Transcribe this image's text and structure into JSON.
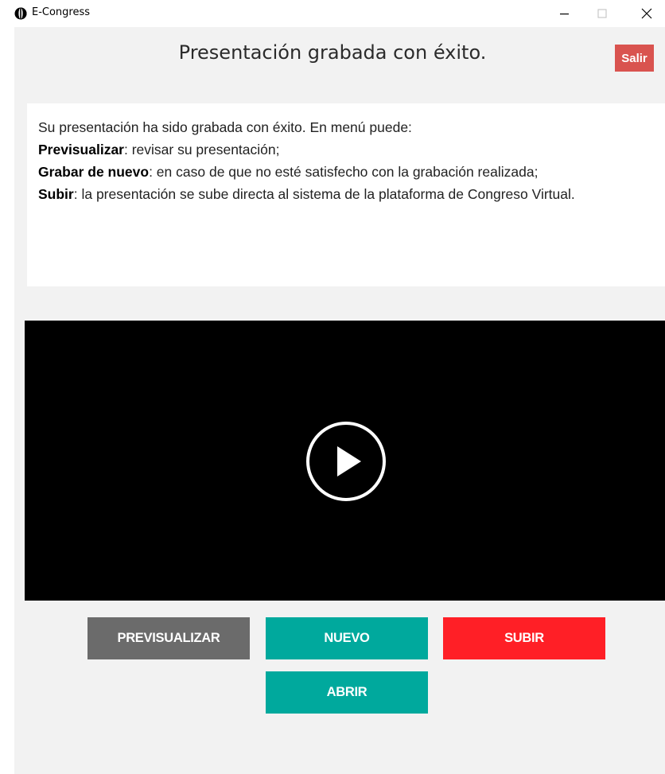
{
  "window": {
    "title": "E-Congress",
    "icon": "e-congress-logo-icon",
    "controls": [
      "minimize-icon",
      "maximize-icon",
      "close-icon"
    ]
  },
  "header": {
    "title": "Presentación grabada con éxito.",
    "exit_label": "Salir"
  },
  "info": {
    "intro": "Su presentación ha sido grabada con éxito. En menú puede:",
    "items": [
      {
        "term": "Previsualizar",
        "desc": ": revisar su presentación;"
      },
      {
        "term": "Grabar de nuevo",
        "desc": ": en caso de que no esté satisfecho con la grabación realizada;"
      },
      {
        "term": "Subir",
        "desc": ": la presentación se sube directa al sistema de la plataforma de Congreso Virtual."
      }
    ]
  },
  "video": {
    "play_icon": "play-circle-icon"
  },
  "actions": {
    "preview_label": "PREVISUALIZAR",
    "new_label": "NUEVO",
    "upload_label": "SUBIR",
    "open_label": "ABRIR"
  },
  "colors": {
    "exit": "#d9534f",
    "preview": "#6b6b6b",
    "teal": "#00a99d",
    "upload": "#ff1f26",
    "background": "#f2f2f2"
  }
}
